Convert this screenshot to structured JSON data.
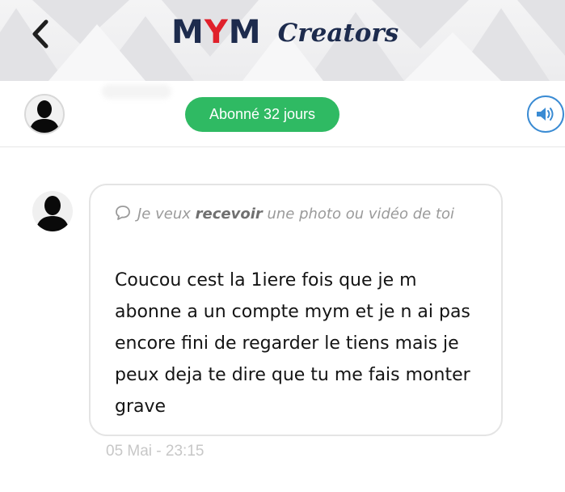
{
  "header": {
    "brand_mym_m1": "M",
    "brand_mym_y": "Y",
    "brand_mym_m2": "M",
    "brand_creators": "Creators",
    "back_icon": "chevron-left-icon"
  },
  "subheader": {
    "avatar_icon": "user-silhouette-icon",
    "subscription_badge": "Abonné 32 jours",
    "sound_icon": "speaker-volume-icon"
  },
  "message": {
    "avatar_icon": "user-silhouette-icon",
    "request_prefix": "Je veux ",
    "request_bold": "recevoir",
    "request_suffix": " une photo ou vidéo de toi",
    "request_icon": "chat-bubble-icon",
    "text": "Coucou cest la 1iere fois que je m abonne a un compte mym et je n ai pas encore fini de regarder le tiens mais je peux deja te dire que tu me fais monter grave",
    "timestamp": "05 Mai - 23:15"
  },
  "colors": {
    "brand_navy": "#1d2b4d",
    "brand_red": "#e0202b",
    "badge_green": "#2fba63",
    "sound_blue": "#3a8bd3"
  }
}
